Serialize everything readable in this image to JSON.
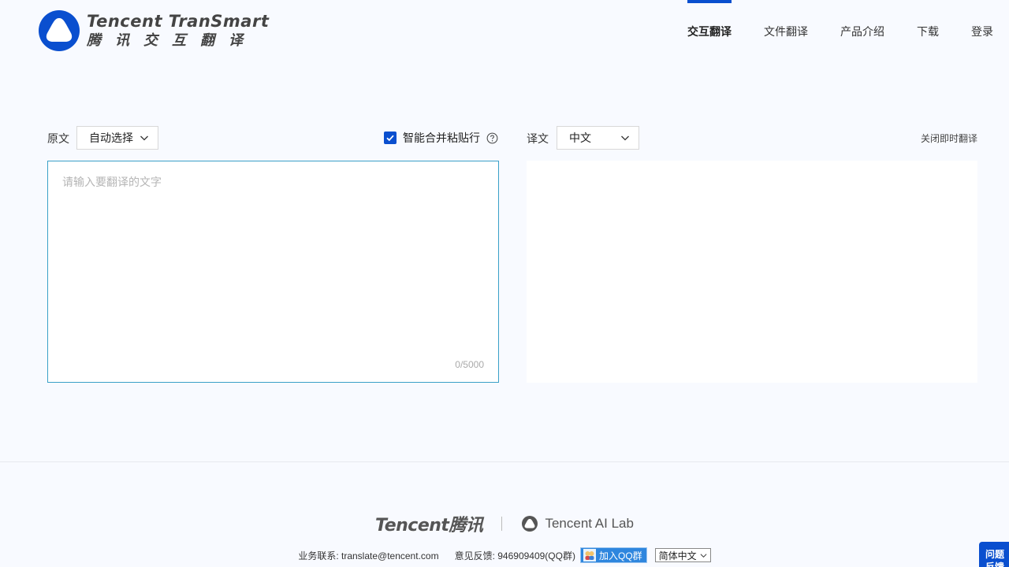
{
  "header": {
    "logo_en": "Tencent TranSmart",
    "logo_cn": "腾讯交互翻译",
    "nav": [
      {
        "label": "交互翻译",
        "active": true
      },
      {
        "label": "文件翻译",
        "active": false
      },
      {
        "label": "产品介绍",
        "active": false
      },
      {
        "label": "下载",
        "active": false
      },
      {
        "label": "登录",
        "active": false
      }
    ]
  },
  "source": {
    "label": "原文",
    "language": "自动选择",
    "merge_lines_label": "智能合并粘贴行",
    "merge_lines_checked": true,
    "placeholder": "请输入要翻译的文字",
    "char_count": "0/5000"
  },
  "target": {
    "label": "译文",
    "language": "中文",
    "close_instant": "关闭即时翻译"
  },
  "footer": {
    "brand_tencent": "Tencent腾讯",
    "brand_ailab": "Tencent AI Lab",
    "business_contact": "业务联系: translate@tencent.com",
    "feedback_contact": "意见反馈: 946909409(QQ群)",
    "qq_button": "加入QQ群",
    "site_language": "简体中文"
  },
  "feedback_tab": {
    "line1": "问题",
    "line2": "反馈"
  },
  "colors": {
    "accent": "#0a4fcf",
    "input_border": "#3aa0c8",
    "background": "#f8faff"
  }
}
